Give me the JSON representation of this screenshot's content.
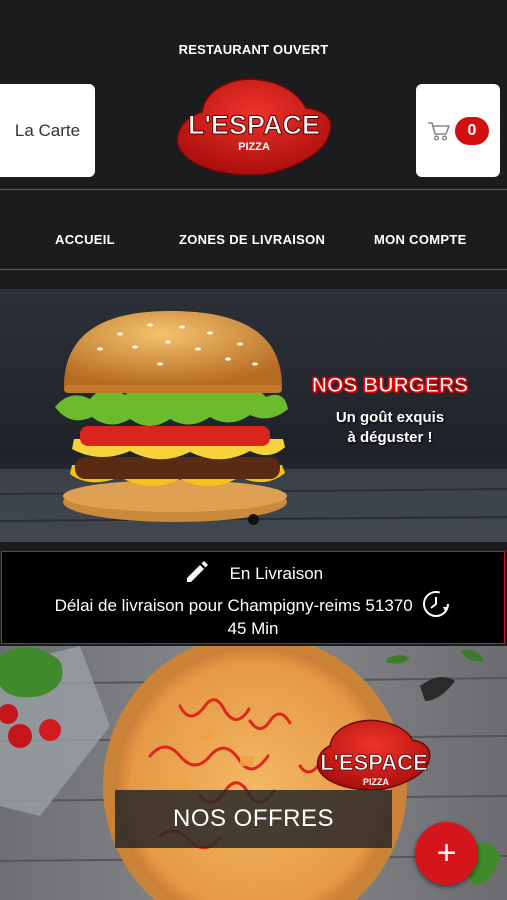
{
  "header": {
    "status": "RESTAURANT OUVERT",
    "menu_label": "La Carte",
    "cart_count": "0",
    "logo_text": "L'ESPACE",
    "logo_sub": "PIZZA"
  },
  "nav": {
    "items": [
      {
        "label": "ACCUEIL"
      },
      {
        "label": "ZONES DE LIVRAISON"
      },
      {
        "label": "MON COMPTE"
      }
    ]
  },
  "hero": {
    "title": "NOS BURGERS",
    "subtitle_1": "Un goût exquis",
    "subtitle_2": "à déguster !"
  },
  "delivery": {
    "mode": "En Livraison",
    "delay_label": "Délai de livraison pour Champigny-reims 51370",
    "delay_value": "45 Min"
  },
  "offers": {
    "label": "NOS OFFRES",
    "logo_text": "L'ESPACE",
    "logo_sub": "PIZZA"
  },
  "fab": {
    "label": "+"
  },
  "colors": {
    "accent": "#d40f0f",
    "background": "#1b1c1e"
  }
}
